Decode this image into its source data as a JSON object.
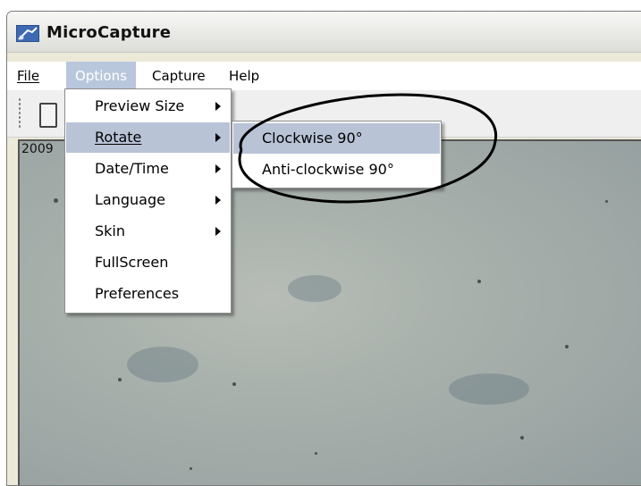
{
  "window": {
    "title": "MicroCapture",
    "icon": "microscope-app-icon"
  },
  "menubar": {
    "items": [
      {
        "label": "File"
      },
      {
        "label": "Options"
      },
      {
        "label": "Capture"
      },
      {
        "label": "Help"
      }
    ],
    "active": "Options"
  },
  "options_menu": {
    "items": [
      {
        "label": "Preview Size",
        "submenu": true
      },
      {
        "label": "Rotate",
        "submenu": true
      },
      {
        "label": "Date/Time",
        "submenu": true
      },
      {
        "label": "Language",
        "submenu": true
      },
      {
        "label": "Skin",
        "submenu": true
      },
      {
        "label": "FullScreen",
        "submenu": false
      },
      {
        "label": "Preferences",
        "submenu": false
      }
    ],
    "highlighted": "Rotate"
  },
  "rotate_submenu": {
    "items": [
      {
        "label": "Clockwise 90°"
      },
      {
        "label": "Anti-clockwise 90°"
      }
    ],
    "highlighted": "Clockwise 90°"
  },
  "preview": {
    "timestamp_text": "2009"
  },
  "colors": {
    "highlight": "#b8c3d6",
    "active_menu": "#b9c7dd",
    "annotation_ellipse": "#000000"
  },
  "annotation": {
    "shape": "hand-drawn-ellipse",
    "target": "rotate-submenu"
  }
}
